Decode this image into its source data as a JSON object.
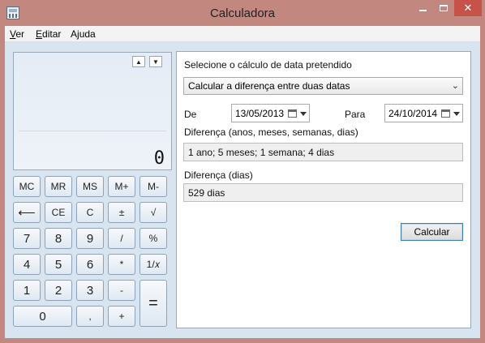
{
  "window": {
    "title": "Calculadora"
  },
  "menu": [
    {
      "label": "Ver",
      "underline": "V",
      "rest": "er"
    },
    {
      "label": "Editar",
      "underline": "E",
      "rest": "ditar"
    },
    {
      "label": "Ajuda",
      "pre": "A",
      "underline": "j",
      "rest": "uda"
    }
  ],
  "display": {
    "value": "0"
  },
  "keypad": {
    "mc": "MC",
    "mr": "MR",
    "ms": "MS",
    "mplus": "M+",
    "mminus": "M-",
    "back": "⟵",
    "ce": "CE",
    "c": "C",
    "plusminus": "±",
    "sqrt": "√",
    "d7": "7",
    "d8": "8",
    "d9": "9",
    "div": "/",
    "pct": "%",
    "d4": "4",
    "d5": "5",
    "d6": "6",
    "mul": "*",
    "inv": "1/𝑥",
    "d1": "1",
    "d2": "2",
    "d3": "3",
    "sub": "-",
    "eq": "=",
    "d0": "0",
    "dot": ",",
    "add": "+"
  },
  "date_panel": {
    "heading": "Selecione o cálculo de data pretendido",
    "mode": "Calcular a diferença entre duas datas",
    "from_label": "De",
    "from_date": "13/05/2013",
    "to_label": "Para",
    "to_date": "24/10/2014",
    "diff_label": "Diferença (anos, meses, semanas, dias)",
    "diff_value": "1 ano; 5 meses; 1 semana; 4 dias",
    "days_label": "Diferença (dias)",
    "days_value": "529 dias",
    "calc_button": "Calcular"
  },
  "colors": {
    "frame": "#c2877f",
    "close": "#c7524a",
    "client": "#d9e4f1"
  }
}
